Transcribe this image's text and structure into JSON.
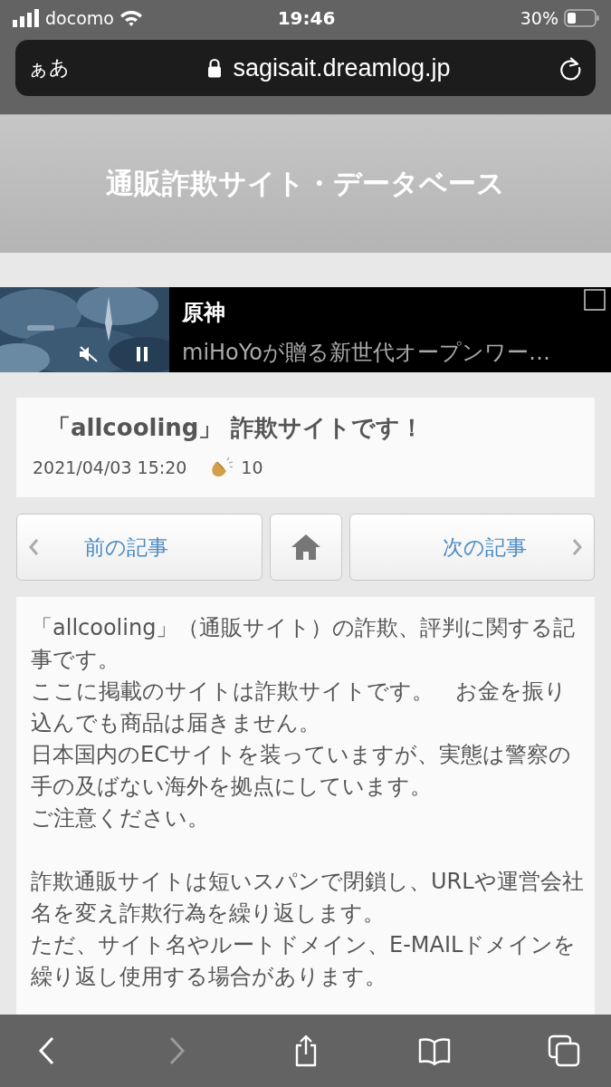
{
  "status_bar": {
    "carrier": "docomo",
    "time": "19:46",
    "battery": "30%"
  },
  "address_bar": {
    "text_size_button": "ぁあ",
    "url": "sagisait.dreamlog.jp"
  },
  "site_header": {
    "title": "通販詐欺サイト・データベース"
  },
  "ad": {
    "title": "原神",
    "description": "miHoYoが贈る新世代オープンワー…"
  },
  "article": {
    "title": "「allcooling」 詐欺サイトです！",
    "date": "2021/04/03 15:20",
    "claps": "10"
  },
  "nav": {
    "previous": "前の記事",
    "next": "次の記事"
  },
  "body": {
    "sections": [
      {
        "paragraphs": [
          "「allcooling」（通販サイト）の詐欺、評判に関する記事です。",
          "ここに掲載のサイトは詐欺サイトです。　お金を振り込んでも商品は届きません。",
          "日本国内のECサイトを装っていますが、実態は警察の手の及ばない海外を拠点にしています。",
          "ご注意ください。"
        ]
      },
      {
        "paragraphs": [
          "詐欺通販サイトは短いスパンで閉鎖し、URLや運営会社名を変え詐欺行為を繰り返します。",
          "ただ、サイト名やルートドメイン、E-MAILドメインを繰り返し使用する場合があります。"
        ]
      }
    ]
  },
  "toolbar": {
    "back_disabled": false,
    "forward_disabled": true
  }
}
